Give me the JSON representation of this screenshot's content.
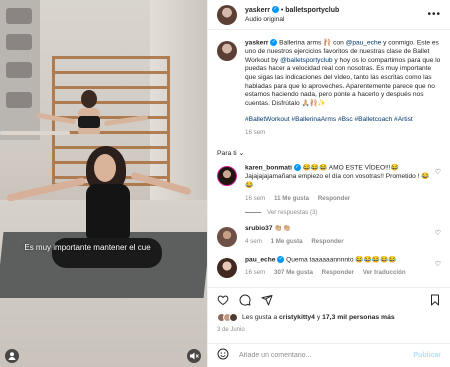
{
  "video": {
    "caption": "Es muy importante mantener el cue",
    "user_tags_icon": "user-icon",
    "mute_icon": "speaker-muted-icon"
  },
  "header": {
    "username": "yaskerr",
    "separator": "•",
    "collab": "balletsportyclub",
    "audio": "Audio original",
    "more": "•••"
  },
  "post": {
    "author": "yaskerr",
    "text_1": " Ballerina arms 🩰 con ",
    "mention_1": "@pau_eche",
    "text_2": " y conmigo. Este es uno de nuestros ejercicios favoritos de nuestras clase de Ballet Workout by ",
    "mention_2": "@balletsportyclub",
    "text_3": " y hoy os lo compartimos para que lo puedas hacer a velocidad real con nosotras. Es muy importante que sigas las indicaciones del vídeo, tanto las escritas como las habladas para que lo aproveches. Aparentemente parece que no estamos haciendo nada, pero ponte a hacerlo y después nos cuentas. Disfrútalo 🙏🏼🩰✨",
    "hashtags": "#BalletWorkout #BallerinaArms #Bsc #Balletcoach #Artist",
    "time": "16 sem"
  },
  "section_label": "Para ti ⌄",
  "comments": [
    {
      "user": "karen_bonmati",
      "text": " 😂😂😂 AMO ESTE VÍDEO!!!😂 Jajajajajamañana empiezo el día con vosotras!! Prometido ! 😂😂",
      "time": "16 sem",
      "likes": "11 Me gusta",
      "reply": "Responder",
      "view_replies": "Ver respuestas (3)"
    },
    {
      "user": "srubio37",
      "text": " 👏🏼👏🏼",
      "time": "4 sem",
      "likes": "1 Me gusta",
      "reply": "Responder"
    },
    {
      "user": "pau_eche",
      "text": " Quema taaaaaannnnto 😂😂😂😂😂",
      "time": "16 sem",
      "likes": "307 Me gusta",
      "reply": "Responder",
      "translate": "Ver traducción"
    }
  ],
  "actions": {
    "likes_prefix": "Les gusta a ",
    "likes_user": "cristykitty4",
    "likes_suffix": " y ",
    "likes_others": "17,3 mil personas más",
    "date": "3 de Junio"
  },
  "add_comment": {
    "placeholder": "Añade un comentario...",
    "post_label": "Publicar",
    "emoji_icon": "smiley-icon"
  },
  "colors": {
    "link": "#00376b",
    "verified": "#0095f6",
    "muted": "#8e8e8e",
    "post_disabled": "#b2dffc"
  }
}
